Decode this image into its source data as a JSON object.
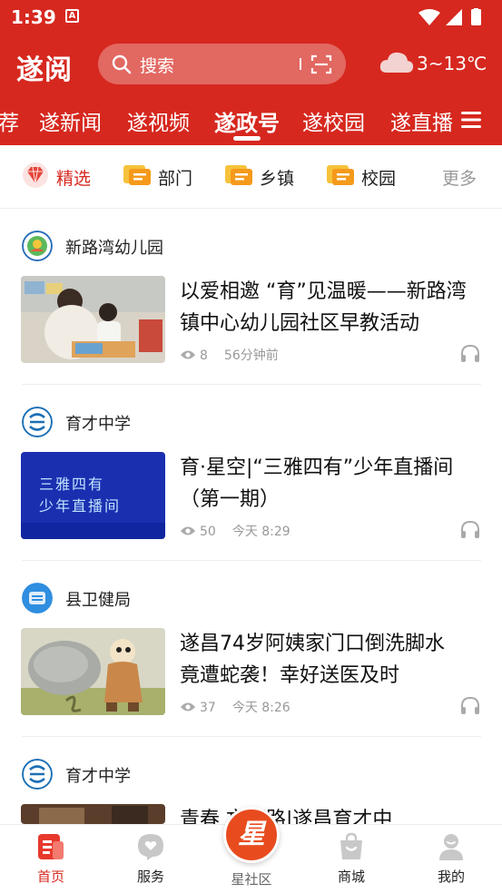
{
  "status_bar": {
    "time": "1:39",
    "app_indicator": "A"
  },
  "header": {
    "logo_text": "遂阅",
    "search_placeholder": "搜索",
    "weather_temp": "3~13℃"
  },
  "tabs": [
    {
      "label": "荐",
      "active": false
    },
    {
      "label": "遂新闻",
      "active": false
    },
    {
      "label": "遂视频",
      "active": false
    },
    {
      "label": "遂政号",
      "active": true
    },
    {
      "label": "遂校园",
      "active": false
    },
    {
      "label": "遂直播",
      "active": false
    }
  ],
  "subcategories": [
    {
      "label": "精选",
      "icon": "diamond-icon",
      "active": true
    },
    {
      "label": "部门",
      "icon": "folder-icon",
      "active": false
    },
    {
      "label": "乡镇",
      "icon": "folder-icon",
      "active": false
    },
    {
      "label": "校园",
      "icon": "folder-icon",
      "active": false
    }
  ],
  "more_label": "更多",
  "feed": [
    {
      "source": "新路湾幼儿园",
      "title_line1": "以爱相邀 “育”见温暖——新路湾",
      "title_line2": "镇中心幼儿园社区早教活动",
      "views": "8",
      "time": "56分钟前",
      "thumb_text_1": "",
      "thumb_text_2": ""
    },
    {
      "source": "育才中学",
      "title_line1": "育·星空|“三雅四有”少年直播间",
      "title_line2": "（第一期）",
      "views": "50",
      "time": "今天 8:29",
      "thumb_text_1": "三雅四有",
      "thumb_text_2": "少年直播间"
    },
    {
      "source": "县卫健局",
      "title_line1": "遂昌74岁阿姨家门口倒洗脚水",
      "title_line2": "竟遭蛇袭！幸好送医及时",
      "views": "37",
      "time": "今天 8:26",
      "thumb_text_1": "",
      "thumb_text_2": ""
    },
    {
      "source": "育才中学",
      "title_line1": "青春 文明路|遂昌育才中",
      "title_line2": "",
      "views": "",
      "time": "",
      "thumb_text_1": "",
      "thumb_text_2": ""
    }
  ],
  "bottom_nav": [
    {
      "label": "首页",
      "icon": "home-news-icon",
      "active": true
    },
    {
      "label": "服务",
      "icon": "service-heart-icon",
      "active": false
    },
    {
      "label": "星社区",
      "icon": "star-community-icon",
      "active": false,
      "badge_char": "星"
    },
    {
      "label": "商城",
      "icon": "shopping-bag-icon",
      "active": false
    },
    {
      "label": "我的",
      "icon": "user-profile-icon",
      "active": false
    }
  ],
  "colors": {
    "brand_red": "#d6281f",
    "accent_orange": "#e84c1e",
    "muted_gray": "#999999"
  }
}
